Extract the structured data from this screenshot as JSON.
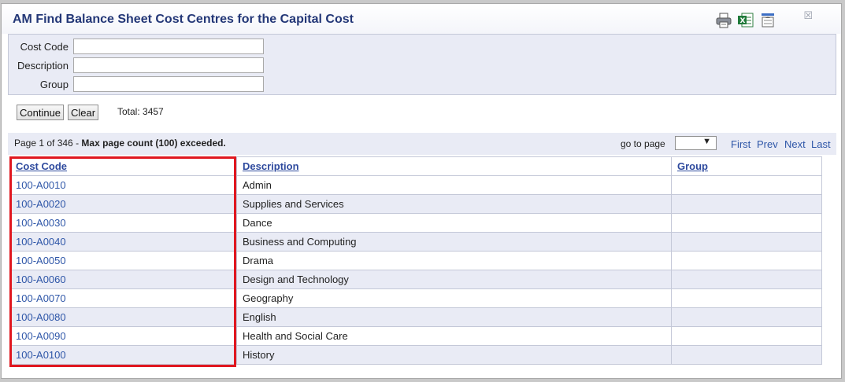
{
  "window": {
    "title": "AM Find Balance Sheet Cost Centres for the Capital Cost",
    "icons": [
      "printer-icon",
      "excel-export-icon",
      "columns-icon"
    ],
    "close_symbol": "☒"
  },
  "filters": {
    "cost_code_label": "Cost Code",
    "cost_code_value": "",
    "description_label": "Description",
    "description_value": "",
    "group_label": "Group",
    "group_value": ""
  },
  "actions": {
    "continue_label": "Continue",
    "clear_label": "Clear",
    "total_text": "Total: 3457"
  },
  "paging": {
    "page_info": "Page 1 of 346 - ",
    "warning": "Max page count (100) exceeded.",
    "goto_label": "go to page",
    "goto_value": "",
    "first": "First",
    "prev": "Prev",
    "next": "Next",
    "last": "Last"
  },
  "table": {
    "headers": [
      "Cost Code",
      "Description",
      "Group"
    ],
    "rows": [
      {
        "code": "100-A0010",
        "description": "Admin",
        "group": ""
      },
      {
        "code": "100-A0020",
        "description": "Supplies and Services",
        "group": ""
      },
      {
        "code": "100-A0030",
        "description": "Dance",
        "group": ""
      },
      {
        "code": "100-A0040",
        "description": "Business and Computing",
        "group": ""
      },
      {
        "code": "100-A0050",
        "description": "Drama",
        "group": ""
      },
      {
        "code": "100-A0060",
        "description": "Design and Technology",
        "group": ""
      },
      {
        "code": "100-A0070",
        "description": "Geography",
        "group": ""
      },
      {
        "code": "100-A0080",
        "description": "English",
        "group": ""
      },
      {
        "code": "100-A0090",
        "description": "Health and Social Care",
        "group": ""
      },
      {
        "code": "100-A0100",
        "description": "History",
        "group": ""
      }
    ]
  },
  "colors": {
    "title": "#233777",
    "panel": "#e9ebf5",
    "link": "#2e56a8",
    "highlight": "#e0171f"
  }
}
